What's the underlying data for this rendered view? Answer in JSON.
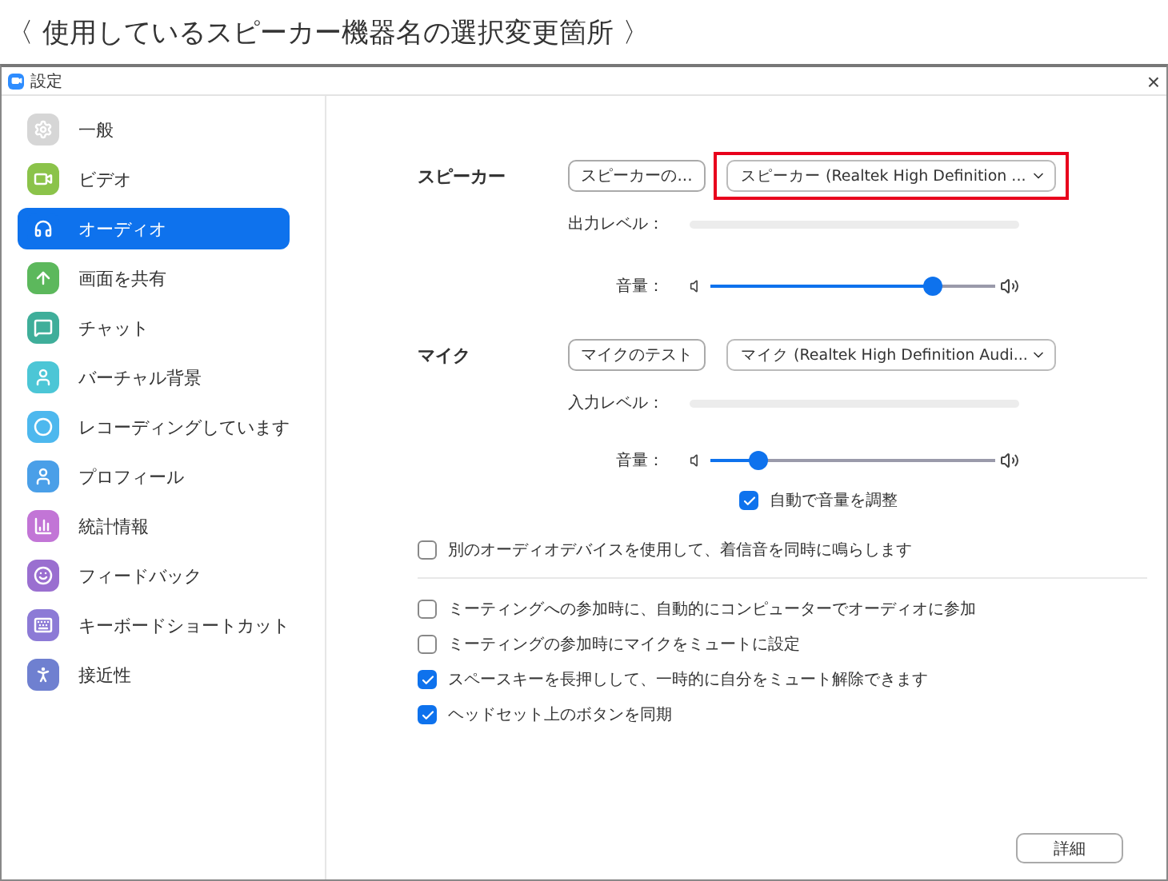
{
  "caption": "〈 使用しているスピーカー機器名の選択変更箇所 〉",
  "window": {
    "title": "設定",
    "close": "×"
  },
  "sidebar": {
    "items": [
      {
        "label": "一般",
        "selected": false,
        "color": "#d6d6d6"
      },
      {
        "label": "ビデオ",
        "selected": false,
        "color": "#8bc34a"
      },
      {
        "label": "オーディオ",
        "selected": true,
        "color": "#0e72ed"
      },
      {
        "label": "画面を共有",
        "selected": false,
        "color": "#5cb85c"
      },
      {
        "label": "チャット",
        "selected": false,
        "color": "#3fae9a"
      },
      {
        "label": "バーチャル背景",
        "selected": false,
        "color": "#4cc6d6"
      },
      {
        "label": "レコーディングしています",
        "selected": false,
        "color": "#4db8ee"
      },
      {
        "label": "プロフィール",
        "selected": false,
        "color": "#4a9fe8"
      },
      {
        "label": "統計情報",
        "selected": false,
        "color": "#c275d6"
      },
      {
        "label": "フィードバック",
        "selected": false,
        "color": "#9a6fd0"
      },
      {
        "label": "キーボードショートカット",
        "selected": false,
        "color": "#8c7ad6"
      },
      {
        "label": "接近性",
        "selected": false,
        "color": "#6f80d0"
      }
    ]
  },
  "speaker": {
    "label": "スピーカー",
    "test_button": "スピーカーの...",
    "device": "スピーカー (Realtek High Definition ...",
    "highlighted": true,
    "level_label": "出力レベル：",
    "volume_label": "音量：",
    "volume": {
      "level": 0.78
    }
  },
  "mic": {
    "label": "マイク",
    "test_button": "マイクのテスト",
    "device": "マイク (Realtek High Definition Audi...",
    "highlighted": false,
    "level_label": "入力レベル：",
    "volume_label": "音量：",
    "volume": {
      "level": 0.17
    },
    "auto_adjust": {
      "label": "自動で音量を調整",
      "checked": true
    }
  },
  "ring_option": {
    "label": "別のオーディオデバイスを使用して、着信音を同時に鳴らします",
    "checked": false
  },
  "options": [
    {
      "label": "ミーティングへの参加時に、自動的にコンピューターでオーディオに参加",
      "checked": false
    },
    {
      "label": "ミーティングの参加時にマイクをミュートに設定",
      "checked": false
    },
    {
      "label": "スペースキーを長押しして、一時的に自分をミュート解除できます",
      "checked": true
    },
    {
      "label": "ヘッドセット上のボタンを同期",
      "checked": true
    }
  ],
  "advanced_button": "詳細"
}
